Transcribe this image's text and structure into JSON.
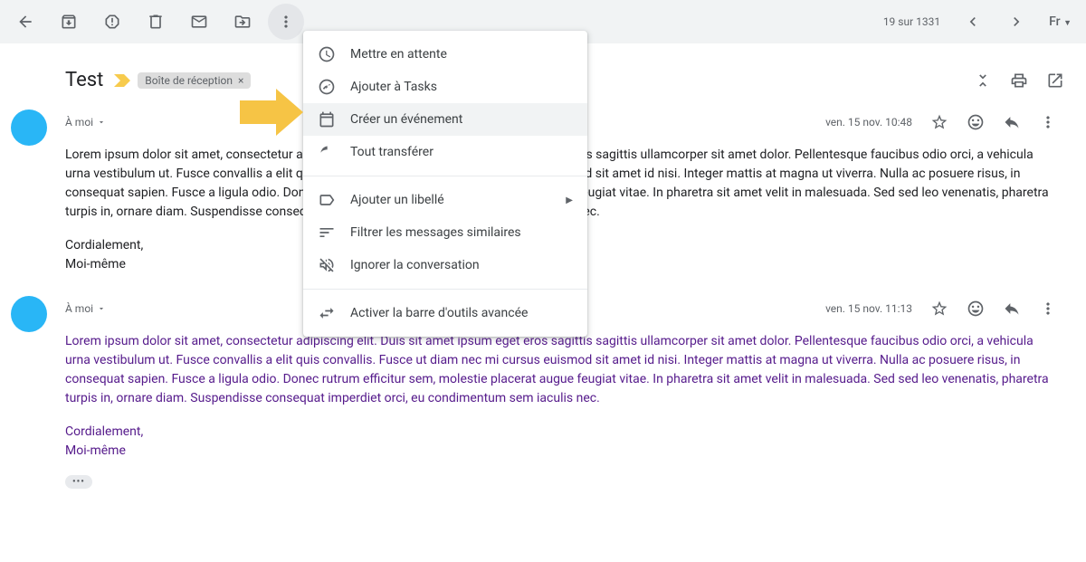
{
  "toolbar": {
    "pagination": "19 sur 1331",
    "language": "Fr"
  },
  "subject": {
    "title": "Test",
    "label": "Boîte de réception"
  },
  "dropdown": {
    "snooze": "Mettre en attente",
    "add_tasks": "Ajouter à Tasks",
    "create_event": "Créer un événement",
    "forward_all": "Tout transférer",
    "add_label": "Ajouter un libellé",
    "filter_similar": "Filtrer les messages similaires",
    "mute": "Ignorer la conversation",
    "activate_toolbar": "Activer la barre d'outils avancée"
  },
  "messages": [
    {
      "recipient": "À moi",
      "date": "ven. 15 nov. 10:48",
      "body": "Lorem ipsum dolor sit amet, consectetur adipiscing elit. Duis sit amet ipsum eget eros sagittis sagittis ullamcorper sit amet dolor. Pellentesque faucibus odio orci, a vehicula urna vestibulum ut. Fusce convallis a elit quis convallis. Fusce ut diam nec mi cursus euismod sit amet id nisi. Integer mattis at magna ut viverra. Nulla ac posuere risus, in consequat sapien. Fusce a ligula odio. Donec rutrum efficitur sem, molestie placerat augue feugiat vitae. In pharetra sit amet velit in malesuada. Sed sed leo venenatis, pharetra turpis in, ornare diam. Suspendisse consequat imperdiet orci, eu condimentum sem iaculis nec.",
      "signoff1": "Cordialement,",
      "signoff2": "Moi-même"
    },
    {
      "recipient": "À moi",
      "date": "ven. 15 nov. 11:13",
      "body": "Lorem ipsum dolor sit amet, consectetur adipiscing elit. Duis sit amet ipsum eget eros sagittis sagittis ullamcorper sit amet dolor. Pellentesque faucibus odio orci, a vehicula urna vestibulum ut. Fusce convallis a elit quis convallis. Fusce ut diam nec mi cursus euismod sit amet id nisi. Integer mattis at magna ut viverra. Nulla ac posuere risus, in consequat sapien. Fusce a ligula odio. Donec rutrum efficitur sem, molestie placerat augue feugiat vitae. In pharetra sit amet velit in malesuada. Sed sed leo venenatis, pharetra turpis in, ornare diam. Suspendisse consequat imperdiet orci, eu condimentum sem iaculis nec.",
      "signoff1": "Cordialement,",
      "signoff2": "Moi-même"
    }
  ]
}
